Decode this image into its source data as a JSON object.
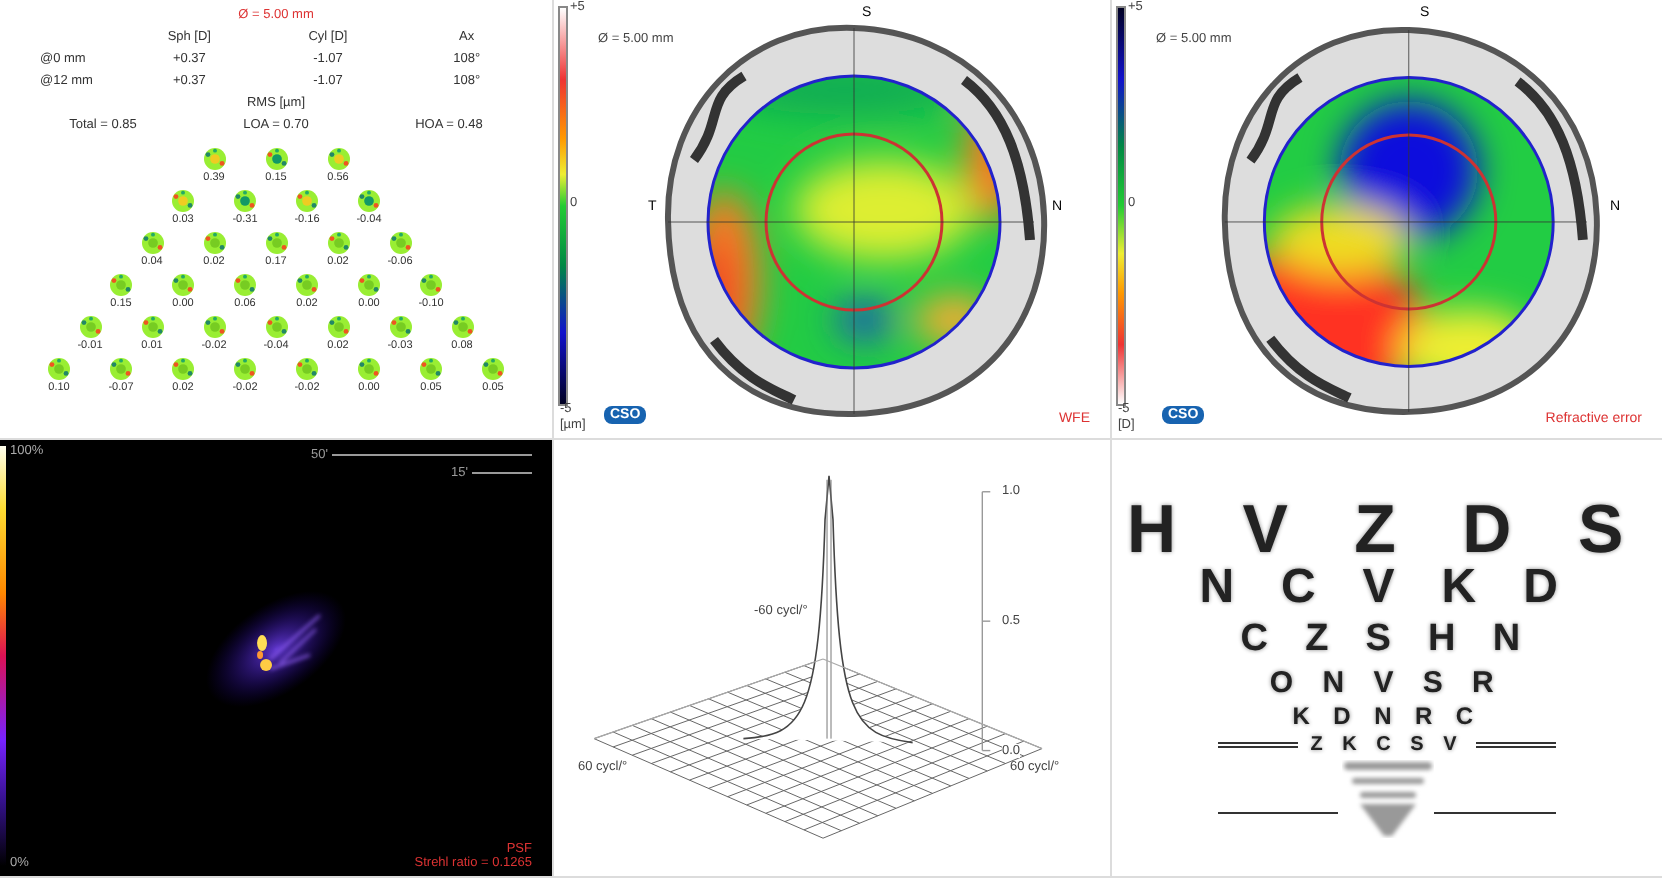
{
  "aberrometry": {
    "diameter": "Ø = 5.00 mm",
    "columns": [
      "Sph [D]",
      "Cyl [D]",
      "Ax"
    ],
    "rows": [
      {
        "label": "@0 mm",
        "values": [
          "+0.37",
          "-1.07",
          "108°"
        ]
      },
      {
        "label": "@12 mm",
        "values": [
          "+0.37",
          "-1.07",
          "108°"
        ]
      }
    ],
    "rms_title": "RMS [µm]",
    "rms": [
      "Total = 0.85",
      "LOA = 0.70",
      "HOA = 0.48"
    ],
    "zernike_rows": [
      [
        "0.39",
        "0.15",
        "0.56"
      ],
      [
        "0.03",
        "-0.31",
        "-0.16",
        "-0.04"
      ],
      [
        "0.04",
        "0.02",
        "0.17",
        "0.02",
        "-0.06"
      ],
      [
        "0.15",
        "0.00",
        "0.06",
        "0.02",
        "0.00",
        "-0.10"
      ],
      [
        "-0.01",
        "0.01",
        "-0.02",
        "-0.04",
        "0.02",
        "-0.03",
        "0.08"
      ],
      [
        "0.10",
        "-0.07",
        "0.02",
        "-0.02",
        "-0.02",
        "0.00",
        "0.05",
        "0.05"
      ]
    ]
  },
  "maps": [
    {
      "kind": "wfe",
      "diameter": "Ø = 5.00 mm",
      "scale_max": "+5",
      "scale_mid": "0",
      "scale_min": "-5",
      "unit": "[µm]",
      "logo": "CSO",
      "title": "WFE",
      "axis_labels": [
        "S",
        "T",
        "N"
      ]
    },
    {
      "kind": "refraction",
      "diameter": "Ø = 5.00 mm",
      "scale_max": "+5",
      "scale_mid": "0",
      "scale_min": "-5",
      "unit": "[D]",
      "logo": "CSO",
      "title": "Refractive error",
      "axis_labels": [
        "S",
        "N"
      ]
    }
  ],
  "psf": {
    "scale_max": "100%",
    "scale_min": "0%",
    "scale_bars": [
      "50'",
      "15'"
    ],
    "title": "PSF",
    "strehl": "Strehl ratio = 0.1265"
  },
  "mtf": {
    "ticks": [
      "1.0",
      "0.5",
      "0.0"
    ],
    "axis_labels": [
      "-60 cycl/°",
      "60 cycl/°",
      "60 cycl/°"
    ]
  },
  "chart": {
    "rows": [
      "H V Z D S",
      "N C V K D",
      "C Z S H N",
      "O N V S R",
      "K D N R C",
      "Z K C S V"
    ]
  }
}
